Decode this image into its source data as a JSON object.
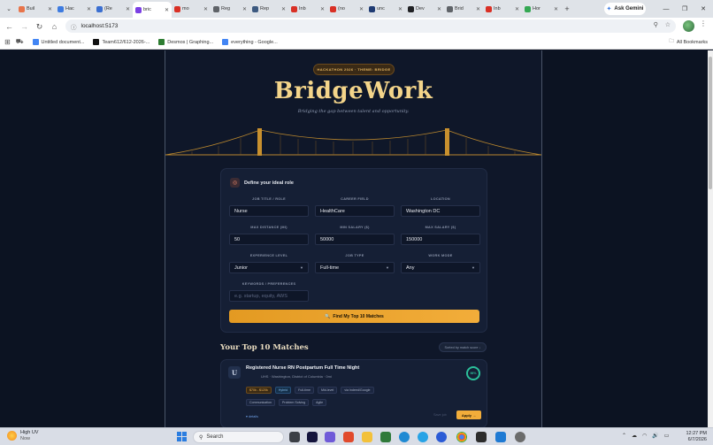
{
  "browser": {
    "tabs": [
      {
        "label": "Buil",
        "color": "#e8744a"
      },
      {
        "label": "Hac",
        "color": "#3d7be0"
      },
      {
        "label": "(Re",
        "color": "#3b6fd1"
      },
      {
        "label": "bric",
        "color": "#7b3fe4",
        "active": true
      },
      {
        "label": "mo",
        "color": "#d93025"
      },
      {
        "label": "Reg",
        "color": "#5f6368"
      },
      {
        "label": "Rep",
        "color": "#3d5a80"
      },
      {
        "label": "Inb",
        "color": "#d93025"
      },
      {
        "label": "(no",
        "color": "#d93025"
      },
      {
        "label": "unc",
        "color": "#1f3b73"
      },
      {
        "label": "Dev",
        "color": "#202124"
      },
      {
        "label": "Brid",
        "color": "#5f6368"
      },
      {
        "label": "Inb",
        "color": "#d93025"
      },
      {
        "label": "Hor",
        "color": "#34a853"
      }
    ],
    "gemini_label": "Ask Gemini",
    "url": "localhost:5173",
    "bookmarks": [
      {
        "label": "Untitled document...",
        "color": "#4285f4"
      },
      {
        "label": "Team612/612-2026-...",
        "color": "#111111"
      },
      {
        "label": "Desmos | Graphing...",
        "color": "#2e7d32"
      },
      {
        "label": "everything - Google...",
        "color": "#4285f4"
      }
    ],
    "all_bookmarks_label": "All Bookmarks"
  },
  "hero": {
    "badge": "HACKATHON 2026 · THEME: BRIDGE",
    "title": "BridgeWork",
    "subtitle": "Bridging the gap between talent and opportunity."
  },
  "form": {
    "heading": "Define your ideal role",
    "fields": {
      "job_title": {
        "label": "JOB TITLE / ROLE",
        "value": "Nurse"
      },
      "career_field": {
        "label": "CAREER FIELD",
        "value": "HealthCare"
      },
      "location": {
        "label": "LOCATION",
        "value": "Washington DC"
      },
      "max_distance": {
        "label": "MAX DISTANCE (MI)",
        "value": "50"
      },
      "min_salary": {
        "label": "MIN SALARY ($)",
        "value": "50000"
      },
      "max_salary": {
        "label": "MAX SALARY ($)",
        "value": "150000"
      },
      "experience": {
        "label": "EXPERIENCE LEVEL",
        "value": "Junior"
      },
      "job_type": {
        "label": "JOB TYPE",
        "value": "Full-time"
      },
      "work_mode": {
        "label": "WORK MODE",
        "value": "Any"
      },
      "keywords": {
        "label": "KEYWORDS / PREFERENCES",
        "placeholder": "e.g. startup, equity, AWS"
      }
    },
    "submit_label": "Find My Top 10 Matches"
  },
  "matches": {
    "title": "Your Top 10 Matches",
    "sort_label": "Sorted by match score ↓",
    "items": [
      {
        "logo_letter": "U",
        "title": "Registered Nurse RN Postpartum Full Time Night",
        "location": "UHS · Washington, District of Columbia · 0mi",
        "score": "96%",
        "tags_row1": [
          "$70k - $120k",
          "Hybrid",
          "Full-time",
          "Mid-level",
          "via Indeed/Google"
        ],
        "tags_row2": [
          "Communication",
          "Problem Solving",
          "Agile"
        ],
        "details_label": "▾ details",
        "saved_label": "Save job",
        "apply_label": "Apply →"
      }
    ]
  },
  "taskbar": {
    "weather_title": "High UV",
    "weather_sub": "Now",
    "search_placeholder": "Search",
    "time": "12:27 PM",
    "date": "6/7/2026"
  }
}
